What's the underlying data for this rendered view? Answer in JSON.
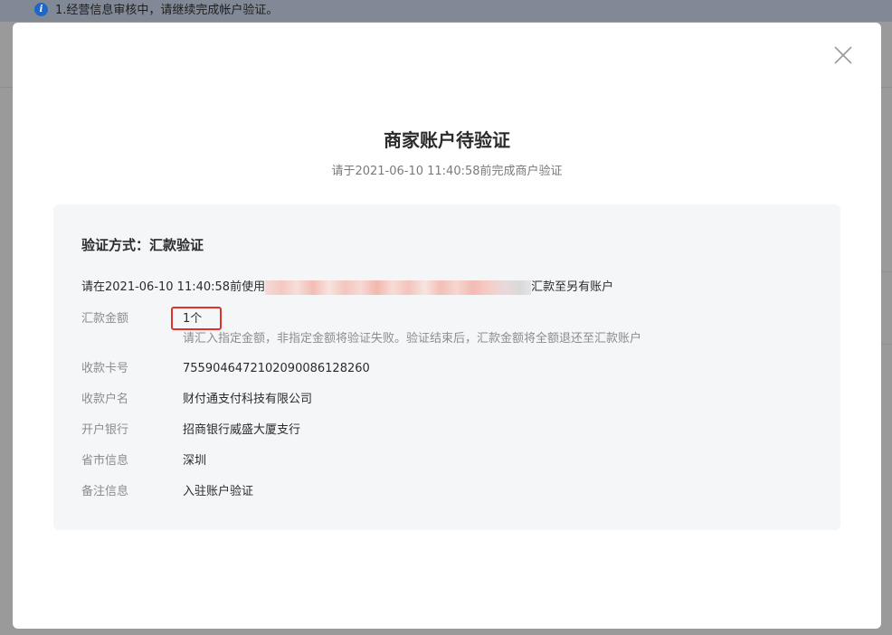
{
  "background": {
    "notice_text": "1.经营信息审核中，请继续完成帐户验证。",
    "notice_icon": "info-icon",
    "notice_icon_glyph": "i"
  },
  "modal": {
    "close_icon": "close-icon",
    "title": "商家账户待验证",
    "subtitle": "请于2021-06-10 11:40:58前完成商户验证",
    "panel": {
      "heading": "验证方式：汇款验证",
      "instruction_prefix": "请在2021-06-10 11:40:58前使用",
      "instruction_suffix": "汇款至另有账户",
      "rows": [
        {
          "label": "汇款金额",
          "value": "1个"
        },
        {
          "label": "收款卡号",
          "value": "755904647210209008612826​0"
        },
        {
          "label": "收款户名",
          "value": "财付通支付科技有限公司"
        },
        {
          "label": "开户银行",
          "value": "招商银行威盛大厦支行"
        },
        {
          "label": "省市信息",
          "value": "深圳"
        },
        {
          "label": "备注信息",
          "value": "入驻账户验证"
        }
      ],
      "amount_hint": "请汇入指定金额，非指定金额将验证失败。验证结束后，汇款金额将全额退还至汇款账户"
    }
  },
  "colors": {
    "highlight_border": "#e0312a",
    "panel_background": "#f5f6f8",
    "info_icon": "#1e66c9"
  }
}
